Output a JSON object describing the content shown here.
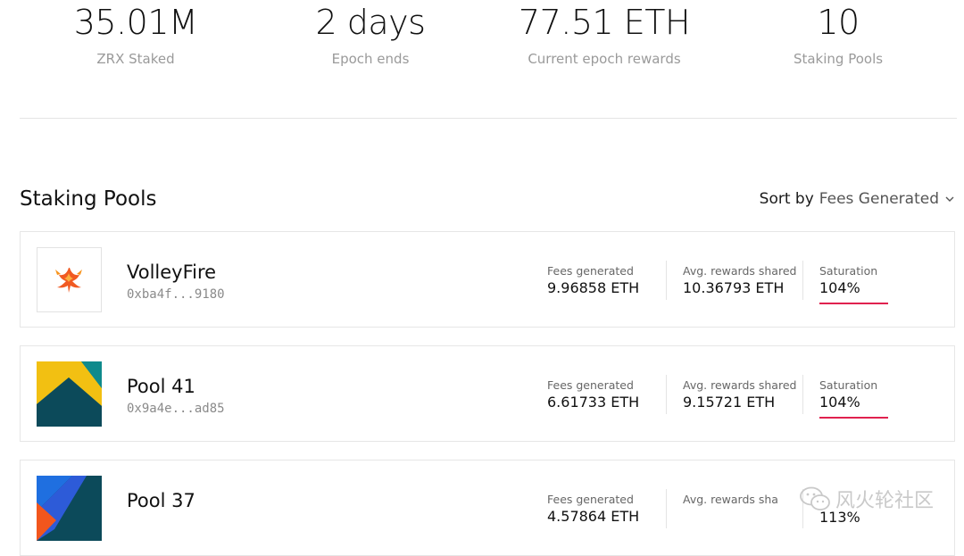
{
  "stats": [
    {
      "value": "35.01M",
      "label": "ZRX Staked"
    },
    {
      "value": "2 days",
      "label": "Epoch ends"
    },
    {
      "value": "77.51 ETH",
      "label": "Current epoch rewards"
    },
    {
      "value": "10",
      "label": "Staking Pools"
    }
  ],
  "section": {
    "title": "Staking Pools",
    "sort_label": "Sort by",
    "sort_value": "Fees Generated",
    "sort_icon": "chevron-down-icon"
  },
  "pools": [
    {
      "name": "VolleyFire",
      "address": "0xba4f...9180",
      "fees_label": "Fees generated",
      "fees_value": "9.96858 ETH",
      "rewards_label": "Avg. rewards shared",
      "rewards_value": "10.36793 ETH",
      "saturation_label": "Saturation",
      "saturation_value": "104%",
      "logo": "phoenix-logo"
    },
    {
      "name": "Pool 41",
      "address": "0x9a4e...ad85",
      "fees_label": "Fees generated",
      "fees_value": "6.61733 ETH",
      "rewards_label": "Avg. rewards shared",
      "rewards_value": "9.15721 ETH",
      "saturation_label": "Saturation",
      "saturation_value": "104%",
      "logo": "geometric-logo"
    },
    {
      "name": "Pool 37",
      "address": "",
      "fees_label": "Fees generated",
      "fees_value": "4.57864 ETH",
      "rewards_label": "Avg. rewards sha",
      "rewards_value": "",
      "saturation_label": "",
      "saturation_value": "113%",
      "logo": "geometric-logo"
    }
  ],
  "watermark": {
    "text": "风火轮社区",
    "icon": "wechat-icon"
  },
  "colors": {
    "accent_red": "#e0214f",
    "text_muted": "#9a9a9a"
  }
}
